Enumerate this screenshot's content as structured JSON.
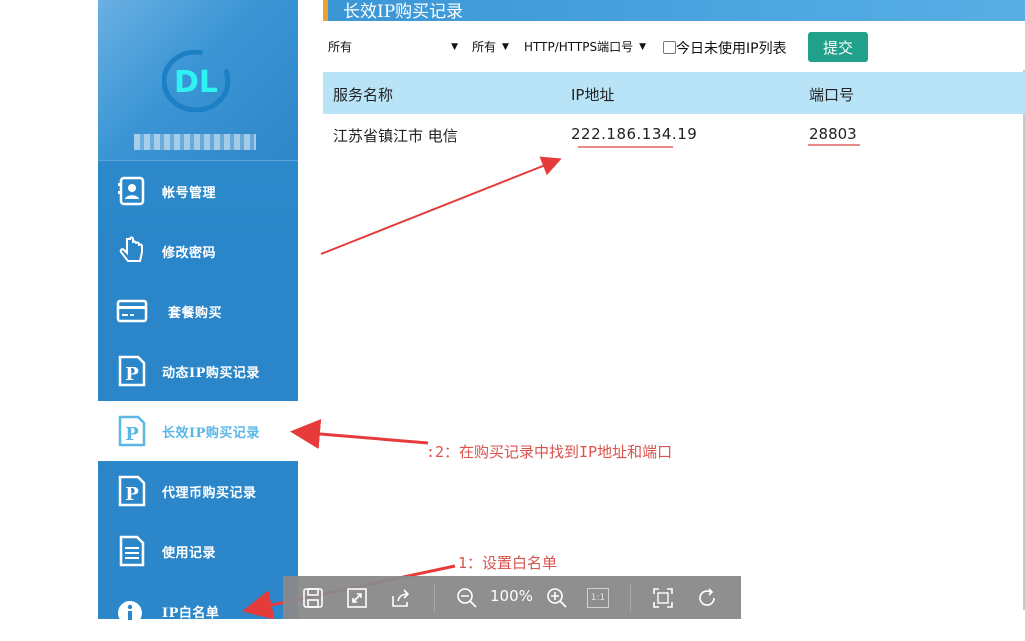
{
  "sidebar": {
    "logo_text": "DL",
    "items": [
      {
        "label": "帐号管理",
        "icon": "contact-card-icon"
      },
      {
        "label": "修改密码",
        "icon": "hand-pointer-icon"
      },
      {
        "label": "套餐购买",
        "icon": "credit-card-icon"
      },
      {
        "label": "动态IP购买记录",
        "icon": "parking-p-icon"
      },
      {
        "label": "长效IP购买记录",
        "icon": "parking-p-icon"
      },
      {
        "label": "代理币购买记录",
        "icon": "parking-p-icon"
      },
      {
        "label": "使用记录",
        "icon": "document-icon"
      },
      {
        "label": "IP白名单",
        "icon": "info-icon"
      }
    ]
  },
  "header": {
    "title": "长效IP购买记录"
  },
  "filters": {
    "select1": "所有",
    "select2": "所有",
    "select3": "HTTP/HTTPS端口号",
    "checkbox_label": "今日未使用IP列表",
    "submit_label": "提交"
  },
  "table": {
    "columns": [
      "服务名称",
      "IP地址",
      "端口号"
    ],
    "rows": [
      {
        "service": "江苏省镇江市 电信",
        "ip": "222.186.134.19",
        "port": "28803"
      }
    ]
  },
  "annotations": {
    "step2": ":2：在购买记录中找到IP地址和端口",
    "step1": "1：设置白名单"
  },
  "viewer": {
    "zoom": "100%",
    "actual_size": "1:1"
  },
  "colors": {
    "sidebar": "#2b87c9",
    "active_text": "#5ab7e6",
    "header_row": "#b9e4f7",
    "submit": "#21a08a",
    "annotation": "#d9534f",
    "title_accent": "#f0a030"
  }
}
